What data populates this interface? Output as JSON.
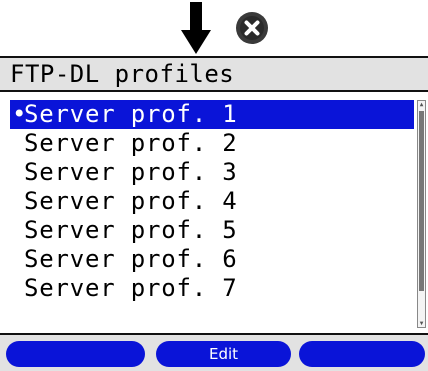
{
  "header": {
    "arrow_icon": "down-arrow-icon",
    "close_icon": "close-icon"
  },
  "title": "FTP-DL profiles",
  "list": {
    "selected_index": 0,
    "selected_marker": "•",
    "items": [
      {
        "label": "Server prof. 1"
      },
      {
        "label": "Server prof. 2"
      },
      {
        "label": "Server prof. 3"
      },
      {
        "label": "Server prof. 4"
      },
      {
        "label": "Server prof. 5"
      },
      {
        "label": "Server prof. 6"
      },
      {
        "label": "Server prof. 7"
      }
    ]
  },
  "softkeys": {
    "left": "",
    "middle": "Edit",
    "right": ""
  },
  "colors": {
    "accent": "#0a14d8",
    "bar_background": "#e2e2e2"
  }
}
